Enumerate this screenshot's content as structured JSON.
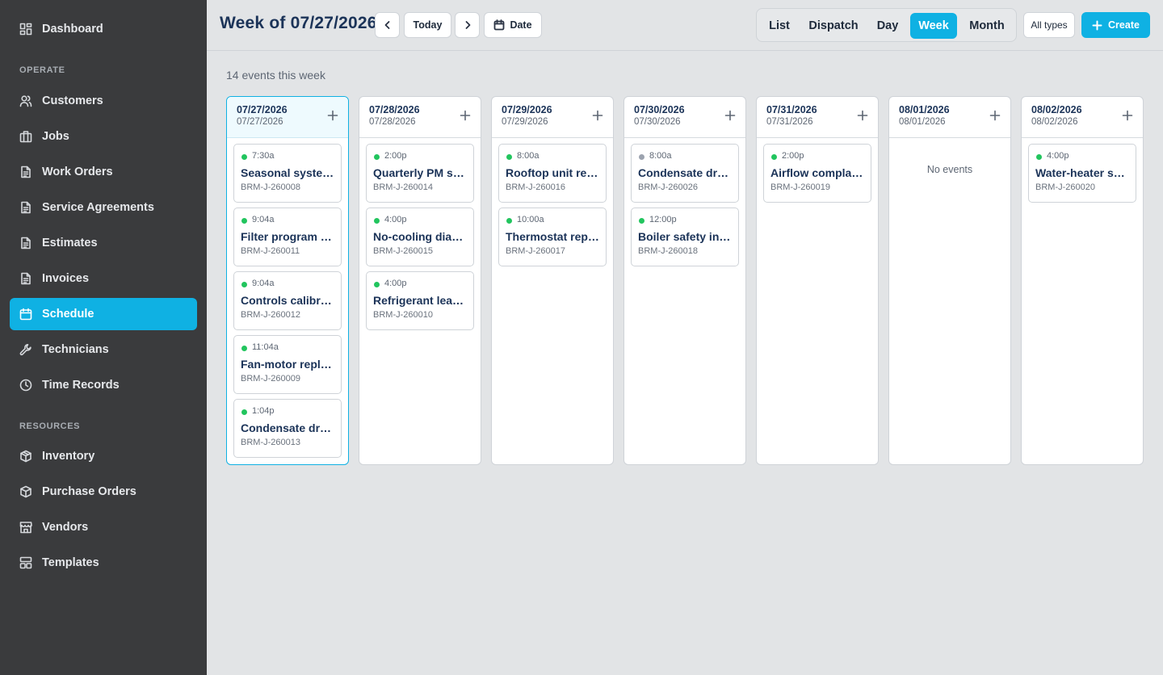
{
  "sidebar": {
    "top_item": {
      "label": "Dashboard",
      "icon": "dashboard-icon"
    },
    "sections": [
      {
        "label": "OPERATE",
        "items": [
          {
            "label": "Customers",
            "icon": "users-icon"
          },
          {
            "label": "Jobs",
            "icon": "briefcase-icon"
          },
          {
            "label": "Work Orders",
            "icon": "document-icon"
          },
          {
            "label": "Service Agreements",
            "icon": "document-icon"
          },
          {
            "label": "Estimates",
            "icon": "document-icon"
          },
          {
            "label": "Invoices",
            "icon": "document-icon"
          },
          {
            "label": "Schedule",
            "icon": "calendar-icon",
            "active": true
          },
          {
            "label": "Technicians",
            "icon": "wrench-icon"
          },
          {
            "label": "Time Records",
            "icon": "clock-icon"
          }
        ]
      },
      {
        "label": "RESOURCES",
        "items": [
          {
            "label": "Inventory",
            "icon": "box-icon"
          },
          {
            "label": "Purchase Orders",
            "icon": "box-icon"
          },
          {
            "label": "Vendors",
            "icon": "store-icon"
          },
          {
            "label": "Templates",
            "icon": "layout-icon"
          }
        ]
      }
    ]
  },
  "header": {
    "title": "Week of 07/27/2026",
    "today_label": "Today",
    "date_label": "Date",
    "views": [
      "List",
      "Dispatch",
      "Day",
      "Week",
      "Month"
    ],
    "active_view": "Week",
    "type_filter": "All types",
    "create_label": "Create"
  },
  "colors": {
    "accent": "#0fb1e3",
    "status_scheduled": "#22c55e",
    "status_pending": "#9ca3af"
  },
  "summary": {
    "events_count_text": "14 events this week"
  },
  "days": [
    {
      "title": "07/27/2026",
      "sub": "07/27/2026",
      "today": true,
      "events": [
        {
          "time": "7:30a",
          "title": "Seasonal system check",
          "code": "BRM-J-260008",
          "status": "green"
        },
        {
          "time": "9:04a",
          "title": "Filter program service",
          "code": "BRM-J-260011",
          "status": "green"
        },
        {
          "time": "9:04a",
          "title": "Controls calibration",
          "code": "BRM-J-260012",
          "status": "green"
        },
        {
          "time": "11:04a",
          "title": "Fan-motor replacement",
          "code": "BRM-J-260009",
          "status": "green"
        },
        {
          "time": "1:04p",
          "title": "Condensate drain clearing",
          "code": "BRM-J-260013",
          "status": "green"
        }
      ]
    },
    {
      "title": "07/28/2026",
      "sub": "07/28/2026",
      "today": false,
      "events": [
        {
          "time": "2:00p",
          "title": "Quarterly PM service",
          "code": "BRM-J-260014",
          "status": "green"
        },
        {
          "time": "4:00p",
          "title": "No-cooling diagnosis",
          "code": "BRM-J-260015",
          "status": "green"
        },
        {
          "time": "4:00p",
          "title": "Refrigerant leak repair",
          "code": "BRM-J-260010",
          "status": "green"
        }
      ]
    },
    {
      "title": "07/29/2026",
      "sub": "07/29/2026",
      "today": false,
      "events": [
        {
          "time": "8:00a",
          "title": "Rooftop unit repair",
          "code": "BRM-J-260016",
          "status": "green"
        },
        {
          "time": "10:00a",
          "title": "Thermostat replacement",
          "code": "BRM-J-260017",
          "status": "green"
        }
      ]
    },
    {
      "title": "07/30/2026",
      "sub": "07/30/2026",
      "today": false,
      "events": [
        {
          "time": "8:00a",
          "title": "Condensate drain clearing",
          "code": "BRM-J-260026",
          "status": "gray"
        },
        {
          "time": "12:00p",
          "title": "Boiler safety inspection",
          "code": "BRM-J-260018",
          "status": "green"
        }
      ]
    },
    {
      "title": "07/31/2026",
      "sub": "07/31/2026",
      "today": false,
      "events": [
        {
          "time": "2:00p",
          "title": "Airflow complaint visit",
          "code": "BRM-J-260019",
          "status": "green"
        }
      ]
    },
    {
      "title": "08/01/2026",
      "sub": "08/01/2026",
      "today": false,
      "empty_text": "No events",
      "events": []
    },
    {
      "title": "08/02/2026",
      "sub": "08/02/2026",
      "today": false,
      "events": [
        {
          "time": "4:00p",
          "title": "Water-heater service",
          "code": "BRM-J-260020",
          "status": "green"
        }
      ]
    }
  ]
}
